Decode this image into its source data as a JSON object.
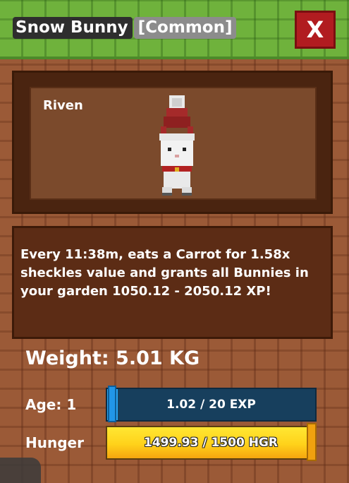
{
  "header": {
    "pet_name": "Snow Bunny",
    "rarity": "[Common]",
    "close_label": "X"
  },
  "preview": {
    "owner": "Riven"
  },
  "description": "Every 11:38m, eats a Carrot for 1.58x sheckles value and grants all Bunnies in your garden 1050.12 - 2050.12 XP!",
  "stats": {
    "weight": "Weight: 5.01 KG",
    "age_label": "Age: 1",
    "exp_text": "1.02 / 20 EXP",
    "exp_fraction": 0.051,
    "hunger_label": "Hunger",
    "hunger_text": "1499.93 / 1500 HGR",
    "hunger_fraction": 0.99995
  },
  "colors": {
    "topbar": "#6fb23c",
    "close_button": "#b11c20",
    "exp_bar": "#173f5d",
    "hunger_bar": "#ffd21a"
  }
}
